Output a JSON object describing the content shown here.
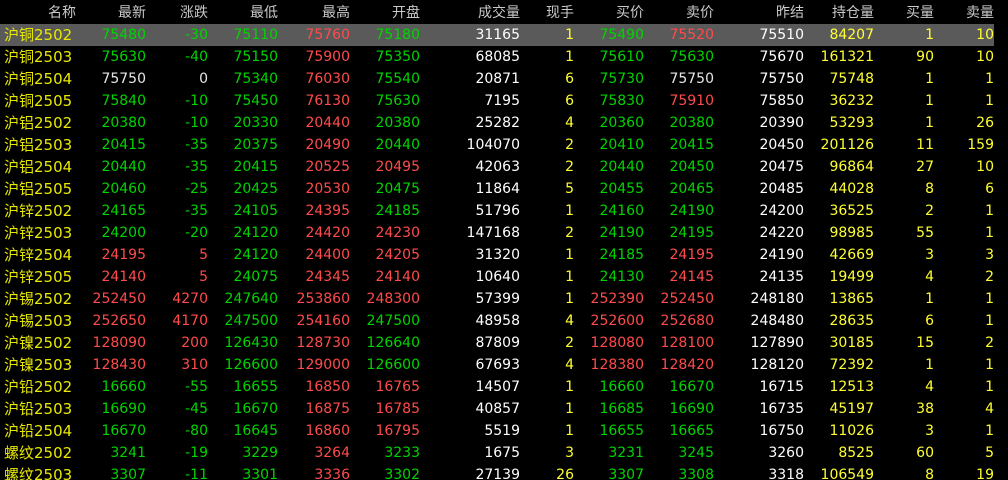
{
  "headers": [
    "名称",
    "最新",
    "涨跌",
    "最低",
    "最高",
    "开盘",
    "成交量",
    "现手",
    "买价",
    "卖价",
    "昨结",
    "持仓量",
    "买量",
    "卖量"
  ],
  "rows": [
    {
      "name": "沪铜2502",
      "last": "75480",
      "chg": "-30",
      "low": "75110",
      "high": "75760",
      "open": "75180",
      "vol": "31165",
      "cur": "1",
      "bid": "75490",
      "ask": "75520",
      "pre": "75510",
      "oi": "84207",
      "bq": "1",
      "aq": "10",
      "sel": true
    },
    {
      "name": "沪铜2503",
      "last": "75630",
      "chg": "-40",
      "low": "75150",
      "high": "75900",
      "open": "75350",
      "vol": "68085",
      "cur": "1",
      "bid": "75610",
      "ask": "75630",
      "pre": "75670",
      "oi": "161321",
      "bq": "90",
      "aq": "10"
    },
    {
      "name": "沪铜2504",
      "last": "75750",
      "chg": "0",
      "low": "75340",
      "high": "76030",
      "open": "75540",
      "vol": "20871",
      "cur": "6",
      "bid": "75730",
      "ask": "75750",
      "pre": "75750",
      "oi": "75748",
      "bq": "1",
      "aq": "1"
    },
    {
      "name": "沪铜2505",
      "last": "75840",
      "chg": "-10",
      "low": "75450",
      "high": "76130",
      "open": "75630",
      "vol": "7195",
      "cur": "6",
      "bid": "75830",
      "ask": "75910",
      "pre": "75850",
      "oi": "36232",
      "bq": "1",
      "aq": "1"
    },
    {
      "name": "沪铝2502",
      "last": "20380",
      "chg": "-10",
      "low": "20330",
      "high": "20440",
      "open": "20380",
      "vol": "25282",
      "cur": "4",
      "bid": "20360",
      "ask": "20380",
      "pre": "20390",
      "oi": "53293",
      "bq": "1",
      "aq": "26"
    },
    {
      "name": "沪铝2503",
      "last": "20415",
      "chg": "-35",
      "low": "20375",
      "high": "20490",
      "open": "20440",
      "vol": "104070",
      "cur": "2",
      "bid": "20410",
      "ask": "20415",
      "pre": "20450",
      "oi": "201126",
      "bq": "11",
      "aq": "159"
    },
    {
      "name": "沪铝2504",
      "last": "20440",
      "chg": "-35",
      "low": "20415",
      "high": "20525",
      "open": "20495",
      "vol": "42063",
      "cur": "2",
      "bid": "20440",
      "ask": "20450",
      "pre": "20475",
      "oi": "96864",
      "bq": "27",
      "aq": "10"
    },
    {
      "name": "沪铝2505",
      "last": "20460",
      "chg": "-25",
      "low": "20425",
      "high": "20530",
      "open": "20475",
      "vol": "11864",
      "cur": "5",
      "bid": "20455",
      "ask": "20465",
      "pre": "20485",
      "oi": "44028",
      "bq": "8",
      "aq": "6"
    },
    {
      "name": "沪锌2502",
      "last": "24165",
      "chg": "-35",
      "low": "24105",
      "high": "24395",
      "open": "24185",
      "vol": "51796",
      "cur": "1",
      "bid": "24160",
      "ask": "24190",
      "pre": "24200",
      "oi": "36525",
      "bq": "2",
      "aq": "1"
    },
    {
      "name": "沪锌2503",
      "last": "24200",
      "chg": "-20",
      "low": "24120",
      "high": "24420",
      "open": "24230",
      "vol": "147168",
      "cur": "2",
      "bid": "24190",
      "ask": "24195",
      "pre": "24220",
      "oi": "98985",
      "bq": "55",
      "aq": "1"
    },
    {
      "name": "沪锌2504",
      "last": "24195",
      "chg": "5",
      "low": "24120",
      "high": "24400",
      "open": "24205",
      "vol": "31320",
      "cur": "1",
      "bid": "24185",
      "ask": "24195",
      "pre": "24190",
      "oi": "42669",
      "bq": "3",
      "aq": "3"
    },
    {
      "name": "沪锌2505",
      "last": "24140",
      "chg": "5",
      "low": "24075",
      "high": "24345",
      "open": "24140",
      "vol": "10640",
      "cur": "1",
      "bid": "24130",
      "ask": "24145",
      "pre": "24135",
      "oi": "19499",
      "bq": "4",
      "aq": "2"
    },
    {
      "name": "沪锡2502",
      "last": "252450",
      "chg": "4270",
      "low": "247640",
      "high": "253860",
      "open": "248300",
      "vol": "57399",
      "cur": "1",
      "bid": "252390",
      "ask": "252450",
      "pre": "248180",
      "oi": "13865",
      "bq": "1",
      "aq": "1"
    },
    {
      "name": "沪锡2503",
      "last": "252650",
      "chg": "4170",
      "low": "247500",
      "high": "254160",
      "open": "247500",
      "vol": "48958",
      "cur": "4",
      "bid": "252600",
      "ask": "252680",
      "pre": "248480",
      "oi": "28635",
      "bq": "6",
      "aq": "1"
    },
    {
      "name": "沪镍2502",
      "last": "128090",
      "chg": "200",
      "low": "126430",
      "high": "128730",
      "open": "126640",
      "vol": "87809",
      "cur": "2",
      "bid": "128080",
      "ask": "128100",
      "pre": "127890",
      "oi": "30185",
      "bq": "15",
      "aq": "2"
    },
    {
      "name": "沪镍2503",
      "last": "128430",
      "chg": "310",
      "low": "126600",
      "high": "129000",
      "open": "126600",
      "vol": "67693",
      "cur": "4",
      "bid": "128380",
      "ask": "128420",
      "pre": "128120",
      "oi": "72392",
      "bq": "1",
      "aq": "1"
    },
    {
      "name": "沪铅2502",
      "last": "16660",
      "chg": "-55",
      "low": "16655",
      "high": "16850",
      "open": "16765",
      "vol": "14507",
      "cur": "1",
      "bid": "16660",
      "ask": "16670",
      "pre": "16715",
      "oi": "12513",
      "bq": "4",
      "aq": "1"
    },
    {
      "name": "沪铅2503",
      "last": "16690",
      "chg": "-45",
      "low": "16670",
      "high": "16875",
      "open": "16785",
      "vol": "40857",
      "cur": "1",
      "bid": "16685",
      "ask": "16690",
      "pre": "16735",
      "oi": "45197",
      "bq": "38",
      "aq": "4"
    },
    {
      "name": "沪铅2504",
      "last": "16670",
      "chg": "-80",
      "low": "16645",
      "high": "16860",
      "open": "16795",
      "vol": "5519",
      "cur": "1",
      "bid": "16655",
      "ask": "16665",
      "pre": "16750",
      "oi": "11026",
      "bq": "3",
      "aq": "1"
    },
    {
      "name": "螺纹2502",
      "last": "3241",
      "chg": "-19",
      "low": "3229",
      "high": "3264",
      "open": "3233",
      "vol": "1675",
      "cur": "3",
      "bid": "3231",
      "ask": "3245",
      "pre": "3260",
      "oi": "8525",
      "bq": "60",
      "aq": "5"
    },
    {
      "name": "螺纹2503",
      "last": "3307",
      "chg": "-11",
      "low": "3301",
      "high": "3336",
      "open": "3302",
      "vol": "27139",
      "cur": "26",
      "bid": "3307",
      "ask": "3308",
      "pre": "3318",
      "oi": "106549",
      "bq": "8",
      "aq": "19"
    }
  ]
}
